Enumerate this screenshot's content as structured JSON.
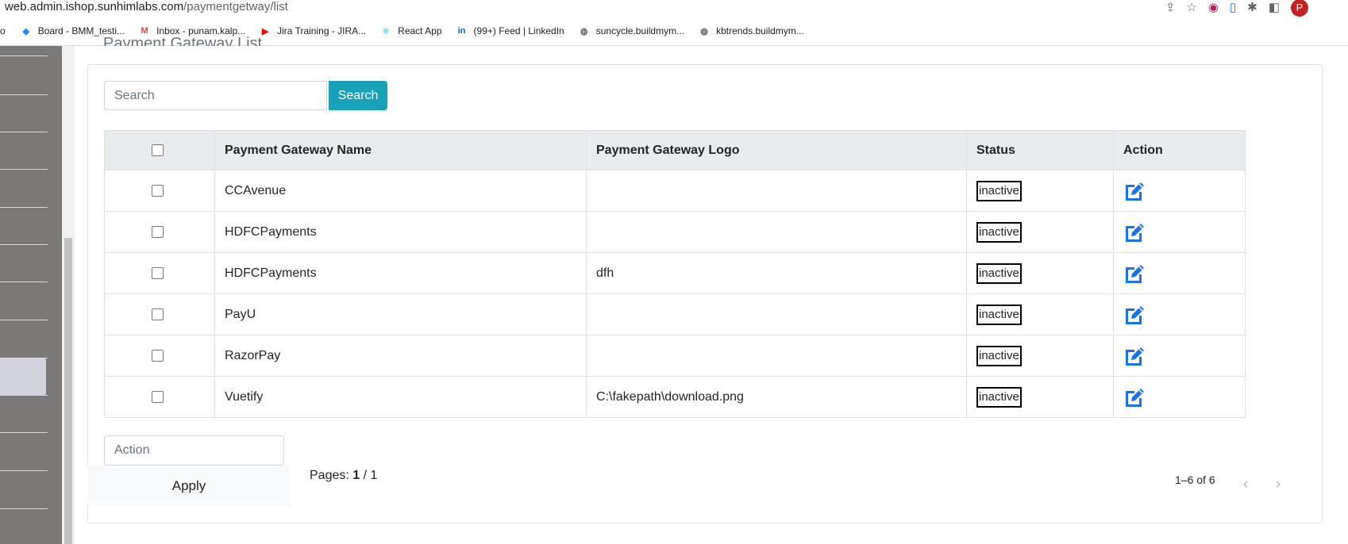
{
  "browser": {
    "url_host": "web.admin.ishop.sunhimlabs.com",
    "url_path": "/paymentgetway/list",
    "profile_initial": "P",
    "bookmarks": [
      {
        "label": "Board - BMM_testi...",
        "icon": "jira-icon",
        "color": "#2684ff"
      },
      {
        "label": "Inbox - punam.kalp...",
        "icon": "gmail-icon",
        "color": "#ea4335"
      },
      {
        "label": "Jira Training - JIRA...",
        "icon": "youtube-icon",
        "color": "#ff0000"
      },
      {
        "label": "React App",
        "icon": "react-icon",
        "color": "#61dafb"
      },
      {
        "label": "(99+) Feed | LinkedIn",
        "icon": "linkedin-icon",
        "color": "#0a66c2"
      },
      {
        "label": "suncycle.buildmym...",
        "icon": "globe-icon",
        "color": "#5f6368"
      },
      {
        "label": "kbtrends.buildmym...",
        "icon": "globe-icon",
        "color": "#5f6368"
      }
    ]
  },
  "page": {
    "title": "Payment Gateway List",
    "search_placeholder": "Search",
    "search_button": "Search",
    "columns": [
      "Payment Gateway Name",
      "Payment Gateway Logo",
      "Status",
      "Action"
    ],
    "rows": [
      {
        "name": "CCAvenue",
        "logo": "",
        "status": "inactive"
      },
      {
        "name": "HDFCPayments",
        "logo": "",
        "status": "inactive"
      },
      {
        "name": "HDFCPayments",
        "logo": "dfh",
        "status": "inactive"
      },
      {
        "name": "PayU",
        "logo": "",
        "status": "inactive"
      },
      {
        "name": "RazorPay",
        "logo": "",
        "status": "inactive"
      },
      {
        "name": "Vuetify",
        "logo": "C:\\fakepath\\download.png",
        "status": "inactive"
      }
    ],
    "action_placeholder": "Action",
    "apply_button": "Apply",
    "pages_label": "Pages:",
    "current_page": "1",
    "page_sep": "/ 1",
    "range_text": "1–6 of 6"
  },
  "colors": {
    "accent": "#17a2b8",
    "edit_icon": "#1a73e8",
    "sidebar": "#7b7878"
  }
}
